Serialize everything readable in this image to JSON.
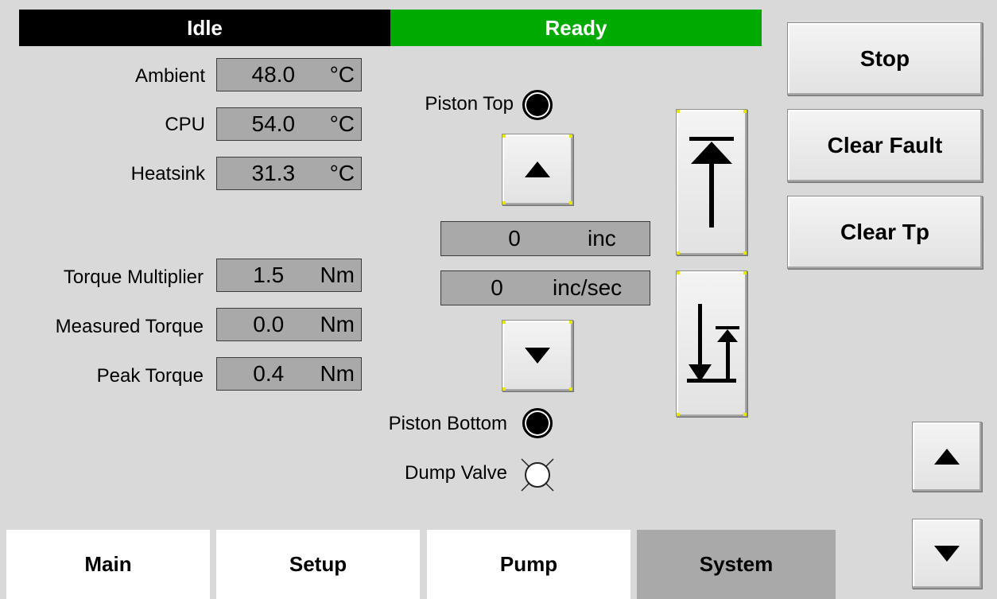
{
  "status": {
    "mode": "Idle",
    "state": "Ready"
  },
  "temperatures": [
    {
      "label": "Ambient",
      "value": "48.0",
      "unit": "°C"
    },
    {
      "label": "CPU",
      "value": "54.0",
      "unit": "°C"
    },
    {
      "label": "Heatsink",
      "value": "31.3",
      "unit": "°C"
    }
  ],
  "torque": [
    {
      "label": "Torque Multiplier",
      "value": "1.5",
      "unit": "Nm"
    },
    {
      "label": "Measured Torque",
      "value": "0.0",
      "unit": "Nm"
    },
    {
      "label": "Peak Torque",
      "value": "0.4",
      "unit": "Nm"
    }
  ],
  "piston": {
    "top_label": "Piston Top",
    "bottom_label": "Piston Bottom",
    "dump_label": "Dump Valve",
    "position": {
      "value": "0",
      "unit": "inc"
    },
    "speed": {
      "value": "0",
      "unit": "inc/sec"
    },
    "jog_up_icon": "triangle-up-icon",
    "jog_down_icon": "triangle-down-icon",
    "home_top_icon": "move-to-top-icon",
    "home_bottom_icon": "move-to-bottom-icon"
  },
  "actions": {
    "stop": "Stop",
    "clear_fault": "Clear Fault",
    "clear_tp": "Clear Tp"
  },
  "tabs": [
    {
      "label": "Main",
      "active": false
    },
    {
      "label": "Setup",
      "active": false
    },
    {
      "label": "Pump",
      "active": false
    },
    {
      "label": "System",
      "active": true
    }
  ],
  "scroll": {
    "up_icon": "triangle-up-icon",
    "down_icon": "triangle-down-icon"
  },
  "colors": {
    "ready": "#00aa00",
    "idle": "#000000",
    "readout": "#a9a9a9",
    "active_tab": "#a9a9a9"
  }
}
